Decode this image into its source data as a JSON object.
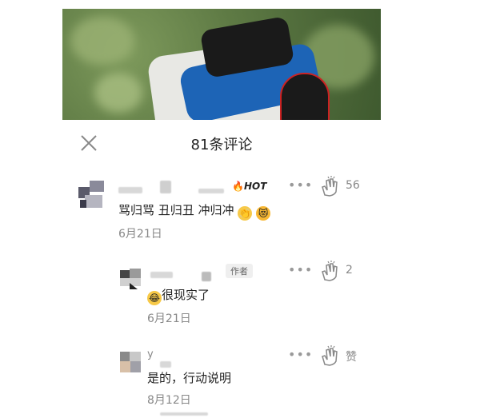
{
  "header": {
    "title": "81条评论"
  },
  "comments": [
    {
      "badge": "HOT",
      "text": "骂归骂 丑归丑 冲归冲",
      "emojis": [
        "clapping-hands",
        "heart-eyes-cat"
      ],
      "date": "6月21日",
      "likes": "56"
    },
    {
      "badge": "作者",
      "text": "很现实了",
      "emojis": [
        "laughing-face"
      ],
      "date": "6月21日",
      "likes": "2"
    },
    {
      "name_char": "y",
      "text": "是的，行动说明",
      "date": "8月12日",
      "likes": "赞"
    }
  ],
  "colors": {
    "hot_flame": "#e53935",
    "muted": "#888888",
    "text": "#222222"
  },
  "icons": {
    "close": "close-icon",
    "more": "more-icon",
    "like": "clap-icon"
  }
}
